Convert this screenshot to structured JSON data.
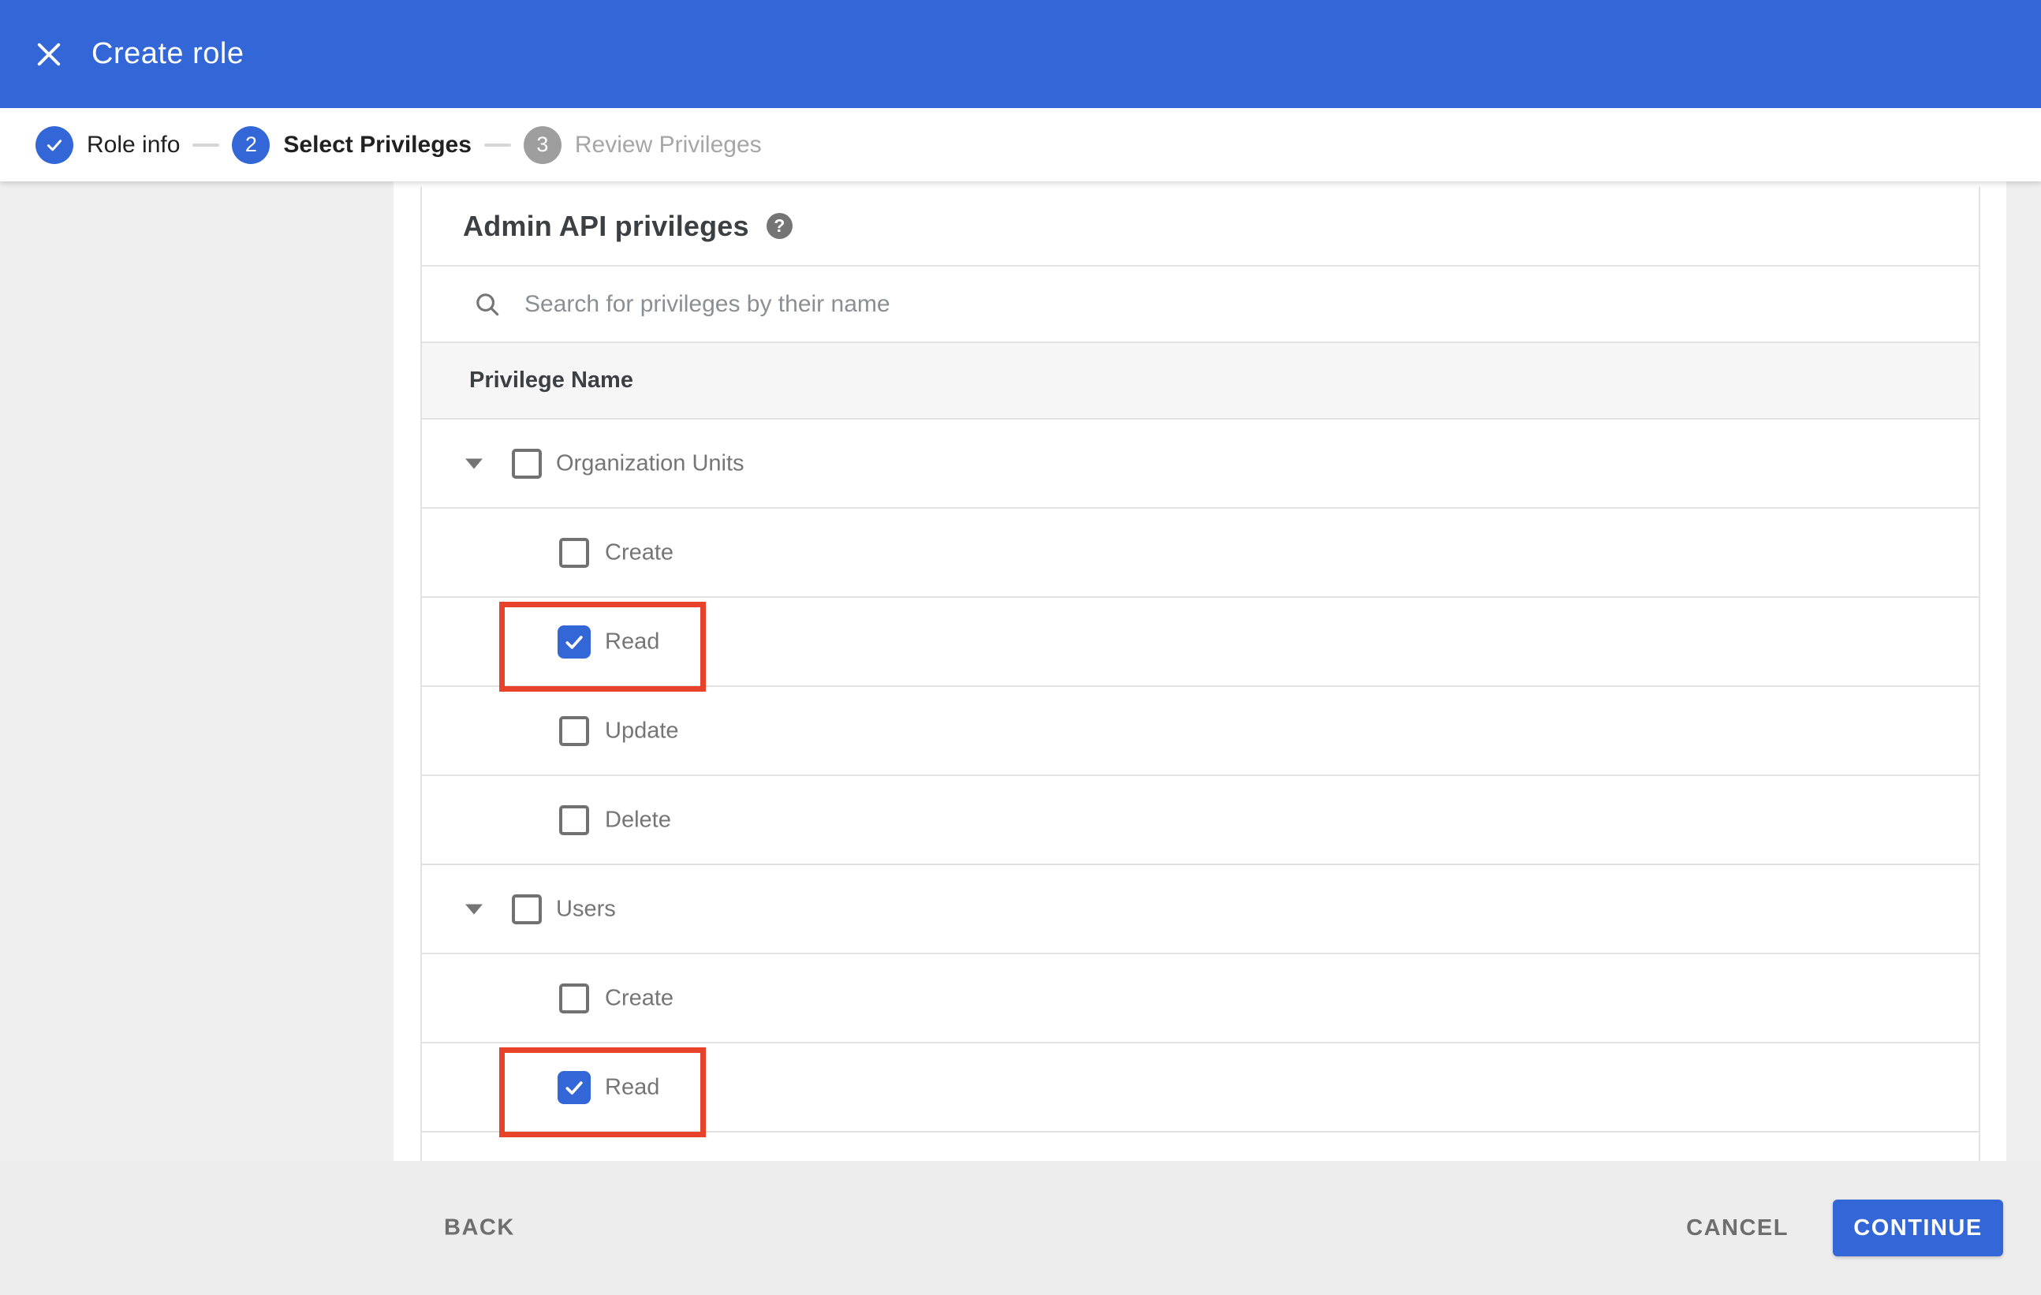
{
  "header": {
    "title": "Create role"
  },
  "stepper": {
    "steps": [
      {
        "label": "Role info",
        "state": "done"
      },
      {
        "label": "Select Privileges",
        "number": "2",
        "state": "active"
      },
      {
        "label": "Review Privileges",
        "number": "3",
        "state": "upcoming"
      }
    ]
  },
  "panel": {
    "title": "Admin API privileges",
    "help_icon": "?",
    "search_placeholder": "Search for privileges by their name",
    "table_header": "Privilege Name"
  },
  "privileges": [
    {
      "label": "Organization Units",
      "type": "group",
      "checked": false,
      "expanded": true,
      "highlighted": false
    },
    {
      "label": "Create",
      "type": "child",
      "checked": false,
      "highlighted": false
    },
    {
      "label": "Read",
      "type": "child",
      "checked": true,
      "highlighted": true
    },
    {
      "label": "Update",
      "type": "child",
      "checked": false,
      "highlighted": false
    },
    {
      "label": "Delete",
      "type": "child",
      "checked": false,
      "highlighted": false
    },
    {
      "label": "Users",
      "type": "group",
      "checked": false,
      "expanded": true,
      "highlighted": false
    },
    {
      "label": "Create",
      "type": "child",
      "checked": false,
      "highlighted": false
    },
    {
      "label": "Read",
      "type": "child",
      "checked": true,
      "highlighted": true
    }
  ],
  "footer": {
    "back_label": "BACK",
    "cancel_label": "CANCEL",
    "continue_label": "CONTINUE"
  },
  "colors": {
    "header_bg": "#3366d6",
    "accent": "#3366d6",
    "highlight": "#e8432a",
    "page_bg": "#efefef",
    "footer_bg": "#ededed",
    "divider": "#e2e2e2",
    "thead_bg": "#f6f6f6"
  }
}
